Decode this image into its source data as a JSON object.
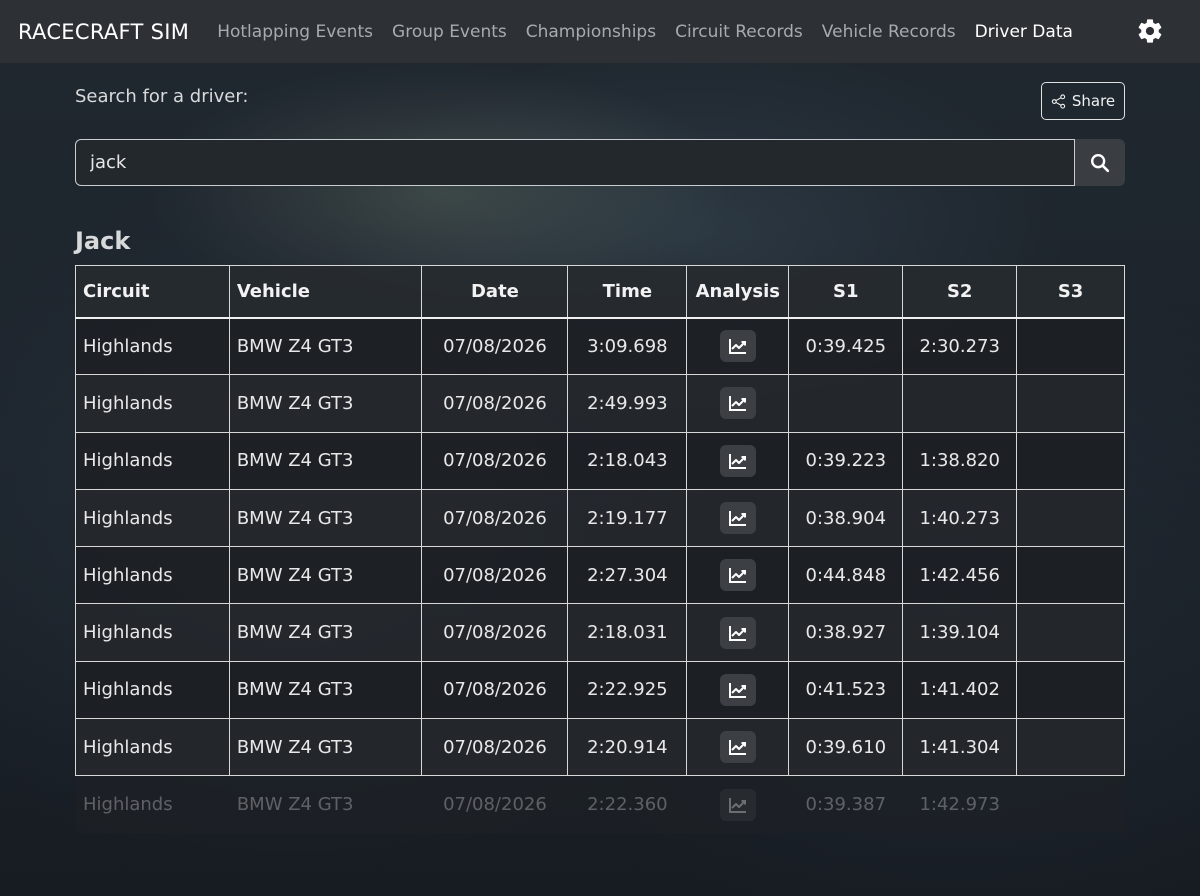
{
  "navbar": {
    "brand": "RACECRAFT SIM",
    "links": [
      {
        "label": "Hotlapping Events",
        "active": false
      },
      {
        "label": "Group Events",
        "active": false
      },
      {
        "label": "Championships",
        "active": false
      },
      {
        "label": "Circuit Records",
        "active": false
      },
      {
        "label": "Vehicle Records",
        "active": false
      },
      {
        "label": "Driver Data",
        "active": true
      }
    ],
    "settings_icon": "gear-icon"
  },
  "search": {
    "label": "Search for a driver:",
    "value": "jack",
    "button_icon": "search-icon"
  },
  "share": {
    "label": "Share",
    "icon": "share-icon"
  },
  "driver": {
    "name": "Jack"
  },
  "table": {
    "headers": [
      "Circuit",
      "Vehicle",
      "Date",
      "Time",
      "Analysis",
      "S1",
      "S2",
      "S3"
    ],
    "rows": [
      {
        "circuit": "Highlands",
        "vehicle": "BMW Z4 GT3",
        "date": "07/08/2026",
        "time": "3:09.698",
        "s1": "0:39.425",
        "s2": "2:30.273",
        "s3": ""
      },
      {
        "circuit": "Highlands",
        "vehicle": "BMW Z4 GT3",
        "date": "07/08/2026",
        "time": "2:49.993",
        "s1": "",
        "s2": "",
        "s3": ""
      },
      {
        "circuit": "Highlands",
        "vehicle": "BMW Z4 GT3",
        "date": "07/08/2026",
        "time": "2:18.043",
        "s1": "0:39.223",
        "s2": "1:38.820",
        "s3": ""
      },
      {
        "circuit": "Highlands",
        "vehicle": "BMW Z4 GT3",
        "date": "07/08/2026",
        "time": "2:19.177",
        "s1": "0:38.904",
        "s2": "1:40.273",
        "s3": ""
      },
      {
        "circuit": "Highlands",
        "vehicle": "BMW Z4 GT3",
        "date": "07/08/2026",
        "time": "2:27.304",
        "s1": "0:44.848",
        "s2": "1:42.456",
        "s3": ""
      },
      {
        "circuit": "Highlands",
        "vehicle": "BMW Z4 GT3",
        "date": "07/08/2026",
        "time": "2:18.031",
        "s1": "0:38.927",
        "s2": "1:39.104",
        "s3": ""
      },
      {
        "circuit": "Highlands",
        "vehicle": "BMW Z4 GT3",
        "date": "07/08/2026",
        "time": "2:22.925",
        "s1": "0:41.523",
        "s2": "1:41.402",
        "s3": ""
      },
      {
        "circuit": "Highlands",
        "vehicle": "BMW Z4 GT3",
        "date": "07/08/2026",
        "time": "2:20.914",
        "s1": "0:39.610",
        "s2": "1:41.304",
        "s3": ""
      },
      {
        "circuit": "Highlands",
        "vehicle": "BMW Z4 GT3",
        "date": "07/08/2026",
        "time": "2:22.360",
        "s1": "0:39.387",
        "s2": "1:42.973",
        "s3": ""
      }
    ],
    "analysis_icon": "line-chart-icon"
  }
}
